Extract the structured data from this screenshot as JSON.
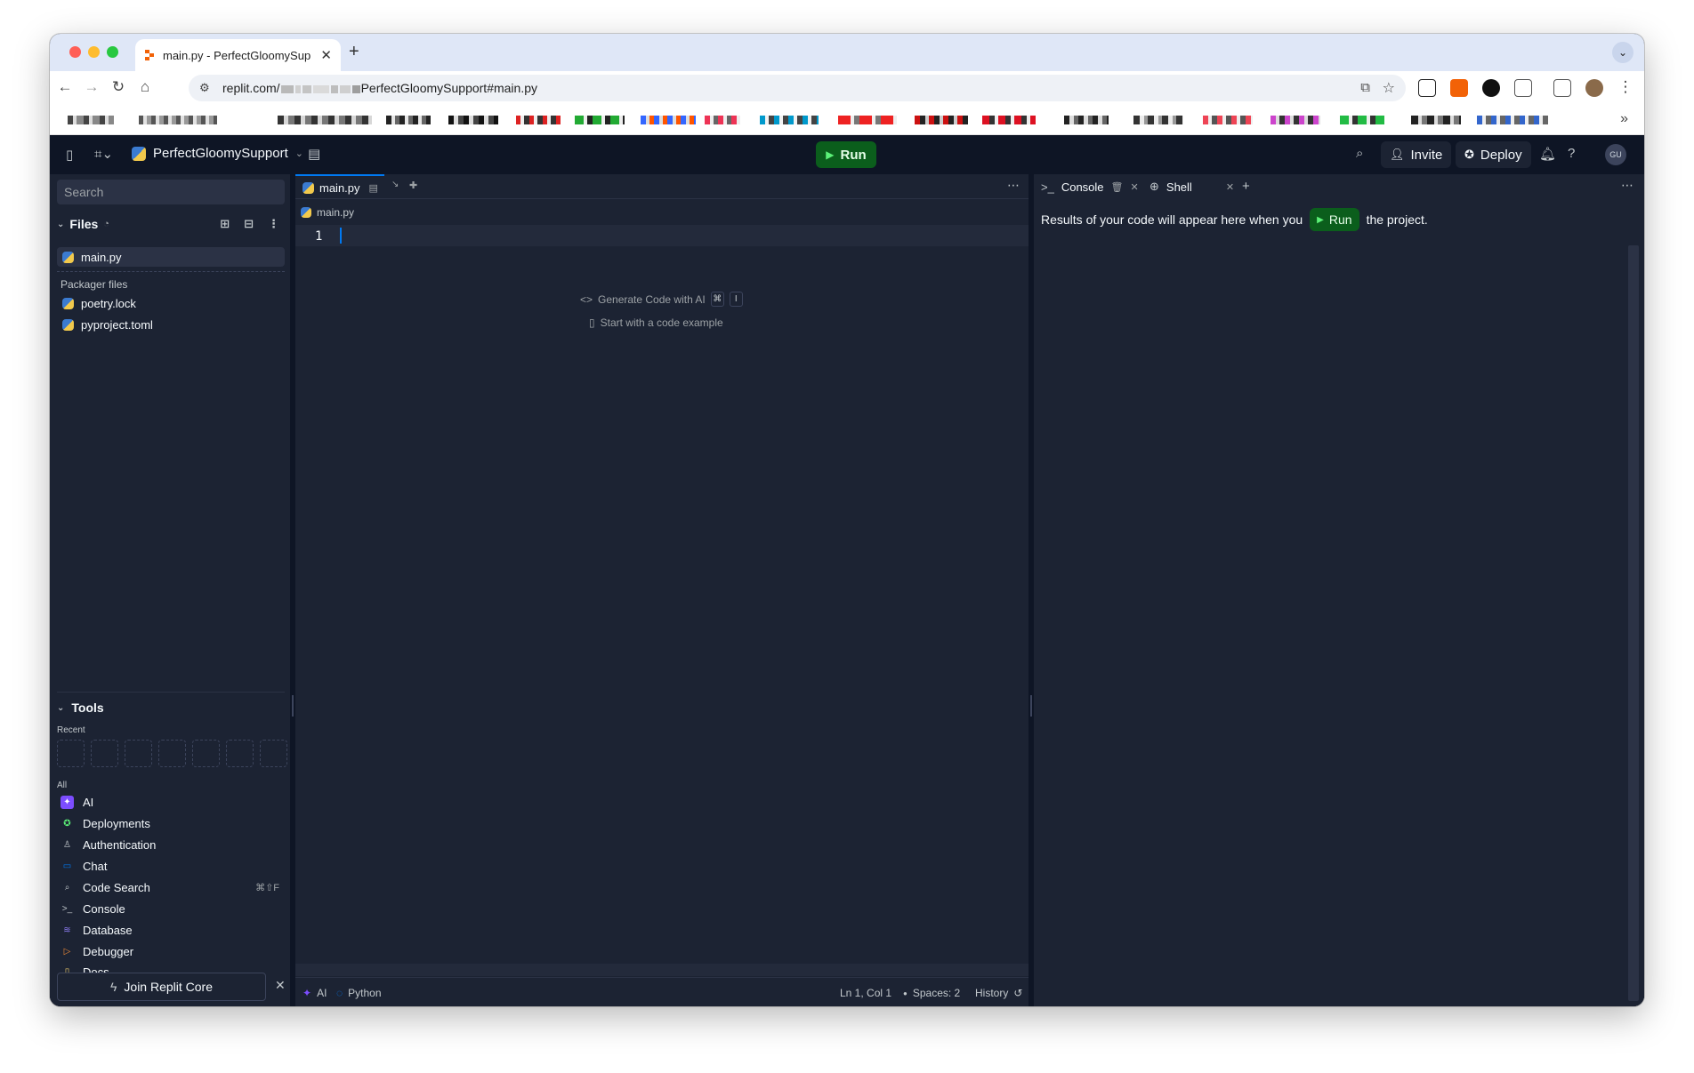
{
  "browser": {
    "tab_title": "main.py - PerfectGloomySup",
    "url_host": "replit.com/",
    "url_path": "PerfectGloomySupport#main.py"
  },
  "header": {
    "project_name": "PerfectGloomySupport",
    "run_label": "Run",
    "invite_label": "Invite",
    "deploy_label": "Deploy",
    "avatar_initials": "GU"
  },
  "sidebar": {
    "search_placeholder": "Search",
    "files_title": "Files",
    "files": [
      {
        "name": "main.py"
      }
    ],
    "packager_label": "Packager files",
    "packager_files": [
      {
        "name": "poetry.lock"
      },
      {
        "name": "pyproject.toml"
      }
    ],
    "tools_title": "Tools",
    "recent_label": "Recent",
    "all_label": "All",
    "tools": [
      {
        "name": "AI",
        "icon": "ai-icon",
        "color": "#7c4dff"
      },
      {
        "name": "Deployments",
        "icon": "deploy-icon",
        "color": "#5cf178"
      },
      {
        "name": "Authentication",
        "icon": "user-icon",
        "color": "#c2c8cc"
      },
      {
        "name": "Chat",
        "icon": "chat-icon",
        "color": "#0079f2"
      },
      {
        "name": "Code Search",
        "icon": "search-icon",
        "color": "#c2c8cc",
        "shortcut": "⌘⇧F"
      },
      {
        "name": "Console",
        "icon": "terminal-icon",
        "color": "#c2c8cc"
      },
      {
        "name": "Database",
        "icon": "database-icon",
        "color": "#8f7ef5"
      },
      {
        "name": "Debugger",
        "icon": "debugger-icon",
        "color": "#f28c38"
      },
      {
        "name": "Docs",
        "icon": "docs-icon",
        "color": "#e8c66b"
      }
    ],
    "join_label": "Join Replit Core"
  },
  "editor": {
    "tab_label": "main.py",
    "breadcrumb": "main.py",
    "line_number": "1",
    "hint_ai": "Generate Code with AI",
    "hint_ai_key1": "⌘",
    "hint_ai_key2": "I",
    "hint_example": "Start with a code example",
    "status": {
      "ai": "AI",
      "language": "Python",
      "position": "Ln 1, Col 1",
      "spaces": "Spaces: 2",
      "history": "History"
    }
  },
  "console": {
    "tab_console": "Console",
    "tab_shell": "Shell",
    "msg_before": "Results of your code will appear here when you",
    "msg_run": "Run",
    "msg_after": "the project."
  },
  "colors": {
    "accent": "#0079f2",
    "run_green": "#0b5e1c",
    "background": "#0e1525",
    "panel": "#1c2333"
  }
}
